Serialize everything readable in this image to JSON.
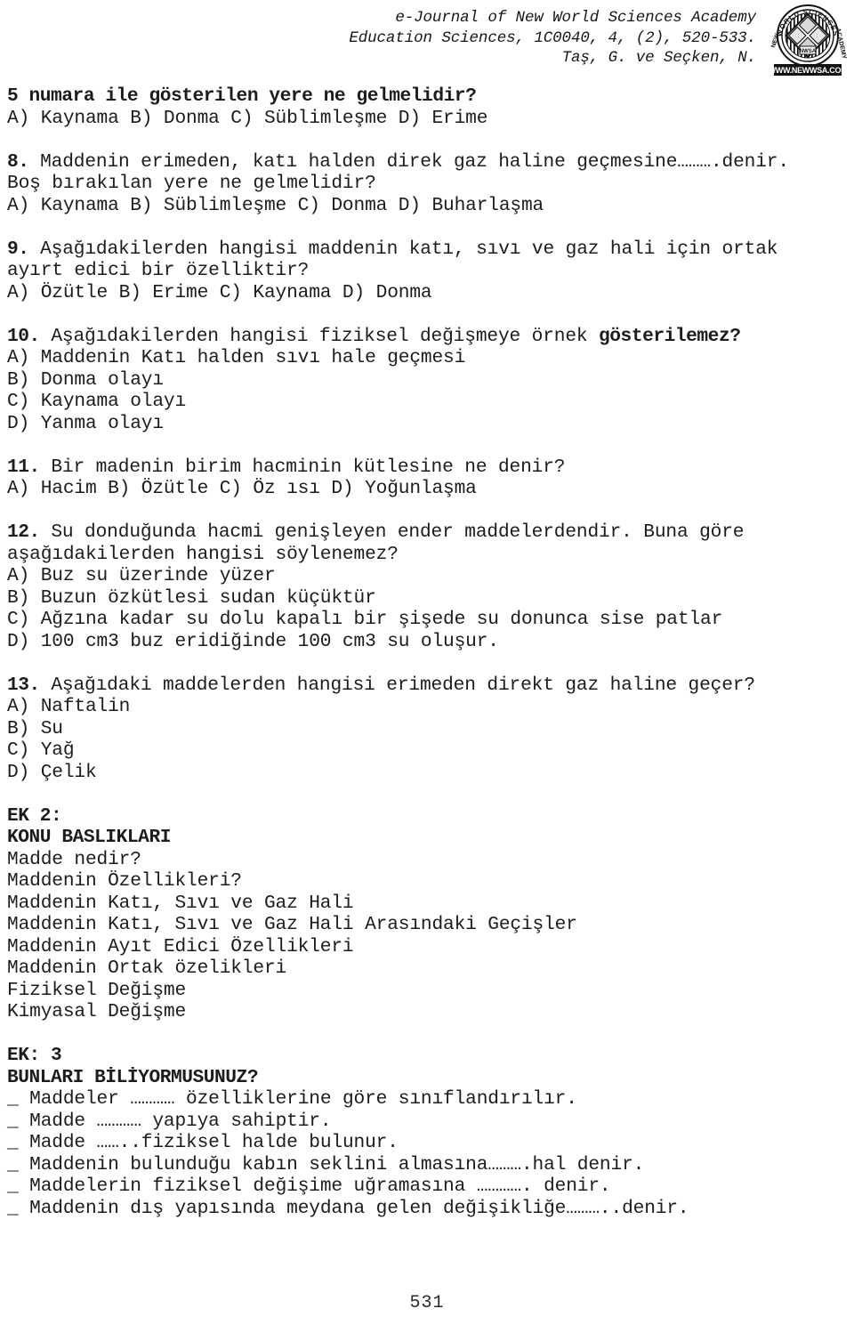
{
  "header": {
    "line1": "e-Journal of New World Sciences Academy",
    "line2": "Education Sciences, 1C0040, 4, (2), 520-533.",
    "line3": "Taş, G. ve Seçken, N.",
    "logo": {
      "ring_top": "WORLD SCIENCES",
      "ring_left": "NEW",
      "ring_right": "ACADEMY",
      "center": "NWSA",
      "url": "WWW.NEWWSA.COM"
    }
  },
  "body": {
    "lines": [
      {
        "id": "q5-stem",
        "text": "5 numara ile gösterilen yere ne gelmelidir?",
        "bold": true
      },
      {
        "id": "q5-opts",
        "text": "A) Kaynama B) Donma C) Süblimleşme D) Erime",
        "bold": false
      },
      {
        "id": "gap-1",
        "text": "",
        "bold": false
      },
      {
        "id": "q8-stem1",
        "text": "8. Maddenin erimeden, katı halden direk gaz haline geçmesine……….denir.",
        "bold": false,
        "bold_prefix": "8."
      },
      {
        "id": "q8-stem2",
        "text": "Boş bırakılan yere ne gelmelidir?",
        "bold": false
      },
      {
        "id": "q8-opts",
        "text": "A) Kaynama B) Süblimleşme C) Donma D) Buharlaşma",
        "bold": false
      },
      {
        "id": "gap-2",
        "text": "",
        "bold": false
      },
      {
        "id": "q9-stem1",
        "text": "9. Aşağıdakilerden hangisi maddenin katı, sıvı ve gaz hali için ortak",
        "bold": false,
        "bold_prefix": "9."
      },
      {
        "id": "q9-stem2",
        "text": "ayırt edici bir özelliktir?",
        "bold": false
      },
      {
        "id": "q9-opts",
        "text": "A) Özütle B) Erime C) Kaynama D) Donma",
        "bold": false
      },
      {
        "id": "gap-3",
        "text": "",
        "bold": false
      },
      {
        "id": "q10-stem",
        "text": "10. Aşağıdakilerden hangisi fiziksel değişmeye örnek gösterilemez?",
        "bold": false,
        "bold_prefix": "10.",
        "bold_suffix": "gösterilemez?"
      },
      {
        "id": "q10-a",
        "text": "A) Maddenin Katı halden sıvı hale geçmesi",
        "bold": false
      },
      {
        "id": "q10-b",
        "text": "B) Donma olayı",
        "bold": false
      },
      {
        "id": "q10-c",
        "text": "C) Kaynama olayı",
        "bold": false
      },
      {
        "id": "q10-d",
        "text": "D) Yanma olayı",
        "bold": false
      },
      {
        "id": "gap-4",
        "text": "",
        "bold": false
      },
      {
        "id": "q11-stem",
        "text": "11. Bir madenin birim hacminin kütlesine ne denir?",
        "bold": false,
        "bold_prefix": "11."
      },
      {
        "id": "q11-opts",
        "text": "A) Hacim B) Özütle C) Öz ısı D) Yoğunlaşma",
        "bold": false
      },
      {
        "id": "gap-5",
        "text": "",
        "bold": false
      },
      {
        "id": "q12-stem1",
        "text": "12. Su donduğunda hacmi genişleyen ender maddelerdendir. Buna göre",
        "bold": false,
        "bold_prefix": "12."
      },
      {
        "id": "q12-stem2",
        "text": "aşağıdakilerden hangisi söylenemez?",
        "bold": false
      },
      {
        "id": "q12-a",
        "text": "A) Buz su üzerinde yüzer",
        "bold": false
      },
      {
        "id": "q12-b",
        "text": "B) Buzun özkütlesi sudan küçüktür",
        "bold": false
      },
      {
        "id": "q12-c",
        "text": "C) Ağzına kadar su dolu kapalı bir şişede su donunca sise patlar",
        "bold": false
      },
      {
        "id": "q12-d",
        "text": "D) 100 cm3 buz eridiğinde 100 cm3 su oluşur.",
        "bold": false
      },
      {
        "id": "gap-6",
        "text": "",
        "bold": false
      },
      {
        "id": "q13-stem",
        "text": "13. Aşağıdaki maddelerden hangisi erimeden direkt gaz haline geçer?",
        "bold": false,
        "bold_prefix": "13."
      },
      {
        "id": "q13-a",
        "text": "A) Naftalin",
        "bold": false
      },
      {
        "id": "q13-b",
        "text": "B) Su",
        "bold": false
      },
      {
        "id": "q13-c",
        "text": "C) Yağ",
        "bold": false
      },
      {
        "id": "q13-d",
        "text": "D) Çelik",
        "bold": false
      },
      {
        "id": "gap-7",
        "text": "",
        "bold": false
      },
      {
        "id": "ek2-head",
        "text": "EK 2:",
        "bold": true
      },
      {
        "id": "ek2-sub",
        "text": "KONU BASLIKLARI",
        "bold": true
      },
      {
        "id": "ek2-l1",
        "text": "Madde nedir?",
        "bold": false
      },
      {
        "id": "ek2-l2",
        "text": "Maddenin Özellikleri?",
        "bold": false
      },
      {
        "id": "ek2-l3",
        "text": "Maddenin Katı, Sıvı ve Gaz Hali",
        "bold": false
      },
      {
        "id": "ek2-l4",
        "text": "Maddenin Katı, Sıvı ve Gaz Hali Arasındaki Geçişler",
        "bold": false
      },
      {
        "id": "ek2-l5",
        "text": "Maddenin Ayıt Edici Özellikleri",
        "bold": false
      },
      {
        "id": "ek2-l6",
        "text": "Maddenin Ortak özelikleri",
        "bold": false
      },
      {
        "id": "ek2-l7",
        "text": "Fiziksel Değişme",
        "bold": false
      },
      {
        "id": "ek2-l8",
        "text": "Kimyasal Değişme",
        "bold": false
      },
      {
        "id": "gap-8",
        "text": "",
        "bold": false
      },
      {
        "id": "ek3-head",
        "text": "EK: 3",
        "bold": true
      },
      {
        "id": "ek3-sub",
        "text": "BUNLARI BİLİYORMUSUNUZ?",
        "bold": true
      }
    ],
    "blank_items": [
      {
        "bullet": "_",
        "text": " Maddeler ………… özelliklerine göre sınıflandırılır."
      },
      {
        "bullet": "_",
        "text": " Madde ………… yapıya sahiptir."
      },
      {
        "bullet": "_",
        "text": " Madde ……..fiziksel halde bulunur."
      },
      {
        "bullet": "_",
        "text": " Maddenin bulunduğu kabın seklini almasına……….hal denir."
      },
      {
        "bullet": "_",
        "text": " Maddelerin fiziksel değişime uğramasına …………. denir."
      },
      {
        "bullet": "_",
        "text": " Maddenin dış yapısında meydana gelen değişikliğe………..denir."
      }
    ]
  },
  "footer": {
    "page_number": "531"
  },
  "colors": {
    "page_background": "#ffffff",
    "text": "#1c1c1c",
    "header_text": "#171717",
    "logo_ink": "#111111"
  }
}
